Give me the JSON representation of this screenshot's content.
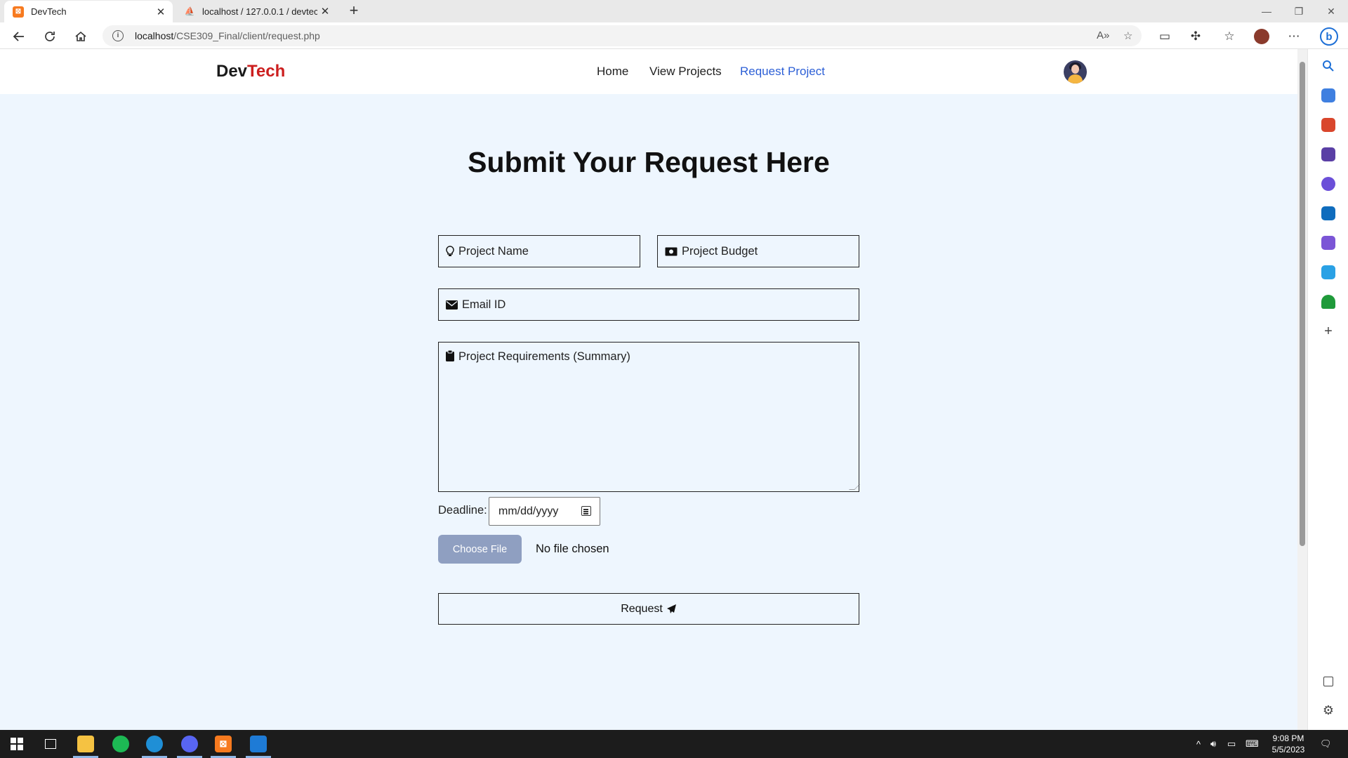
{
  "browser": {
    "tabs": [
      {
        "title": "DevTech",
        "active": true,
        "favicon": "xampp-icon"
      },
      {
        "title": "localhost / 127.0.0.1 / devtech / |",
        "active": false,
        "favicon": "phpmyadmin-icon"
      }
    ],
    "new_tab": "+",
    "url_host": "localhost",
    "url_path": "/CSE309_Final/client/request.php"
  },
  "nav": {
    "brand_dev": "Dev",
    "brand_tech": "Tech",
    "links": [
      "Home",
      "View Projects",
      "Request Project"
    ],
    "active_link": "Request Project"
  },
  "form": {
    "heading": "Submit Your Request Here",
    "project_name": "Project Name",
    "project_budget": "Project Budget",
    "email": "Email ID",
    "requirements": "Project Requirements (Summary)",
    "deadline_label": "Deadline:",
    "deadline_placeholder": "mm/dd/yyyy",
    "choose_file": "Choose File",
    "file_status": "No file chosen",
    "submit": "Request"
  },
  "taskbar": {
    "time": "9:08 PM",
    "date": "5/5/2023"
  },
  "colors": {
    "page_bg": "#eef6fe",
    "brand_red": "#cc1f1f",
    "active_link": "#2c5fd6",
    "file_button": "#8f9fc1"
  }
}
